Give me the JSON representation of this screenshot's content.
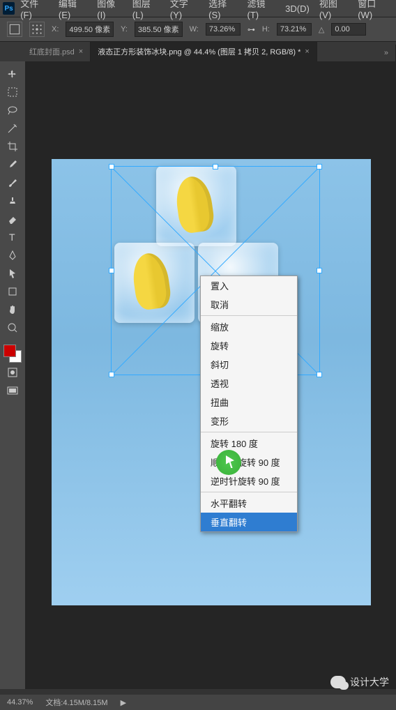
{
  "menu": {
    "items": [
      "文件(F)",
      "编辑(E)",
      "图像(I)",
      "图层(L)",
      "文字(Y)",
      "选择(S)",
      "滤镜(T)",
      "3D(D)",
      "视图(V)",
      "窗口(W)"
    ]
  },
  "options": {
    "x_label": "X:",
    "x_value": "499.50 像素",
    "y_label": "Y:",
    "y_value": "385.50 像素",
    "w_label": "W:",
    "w_value": "73.26%",
    "h_label": "H:",
    "h_value": "73.21%",
    "angle_label": "△",
    "angle_value": "0.00"
  },
  "tabs": [
    {
      "label": "红底封面.psd",
      "active": false
    },
    {
      "label": "液态正方形装饰冰块.png @ 44.4% (图层 1 拷贝 2, RGB/8) *",
      "active": true
    }
  ],
  "context_menu": {
    "groups": [
      [
        "置入",
        "取消"
      ],
      [
        "缩放",
        "旋转",
        "斜切",
        "透视",
        "扭曲",
        "变形"
      ],
      [
        "旋转 180 度",
        "顺时针旋转 90 度",
        "逆时针旋转 90 度"
      ],
      [
        "水平翻转",
        "垂直翻转"
      ]
    ],
    "hovered": "垂直翻转"
  },
  "status": {
    "zoom": "44.37%",
    "doc_label": "文档:",
    "doc_value": "4.15M/8.15M"
  },
  "watermark": "设计大学",
  "tools": [
    "move",
    "marquee",
    "lasso",
    "magic-wand",
    "crop",
    "eyedropper",
    "brush",
    "clone",
    "eraser",
    "gradient",
    "blur",
    "type",
    "pen",
    "path-select",
    "rectangle",
    "hand",
    "zoom"
  ]
}
